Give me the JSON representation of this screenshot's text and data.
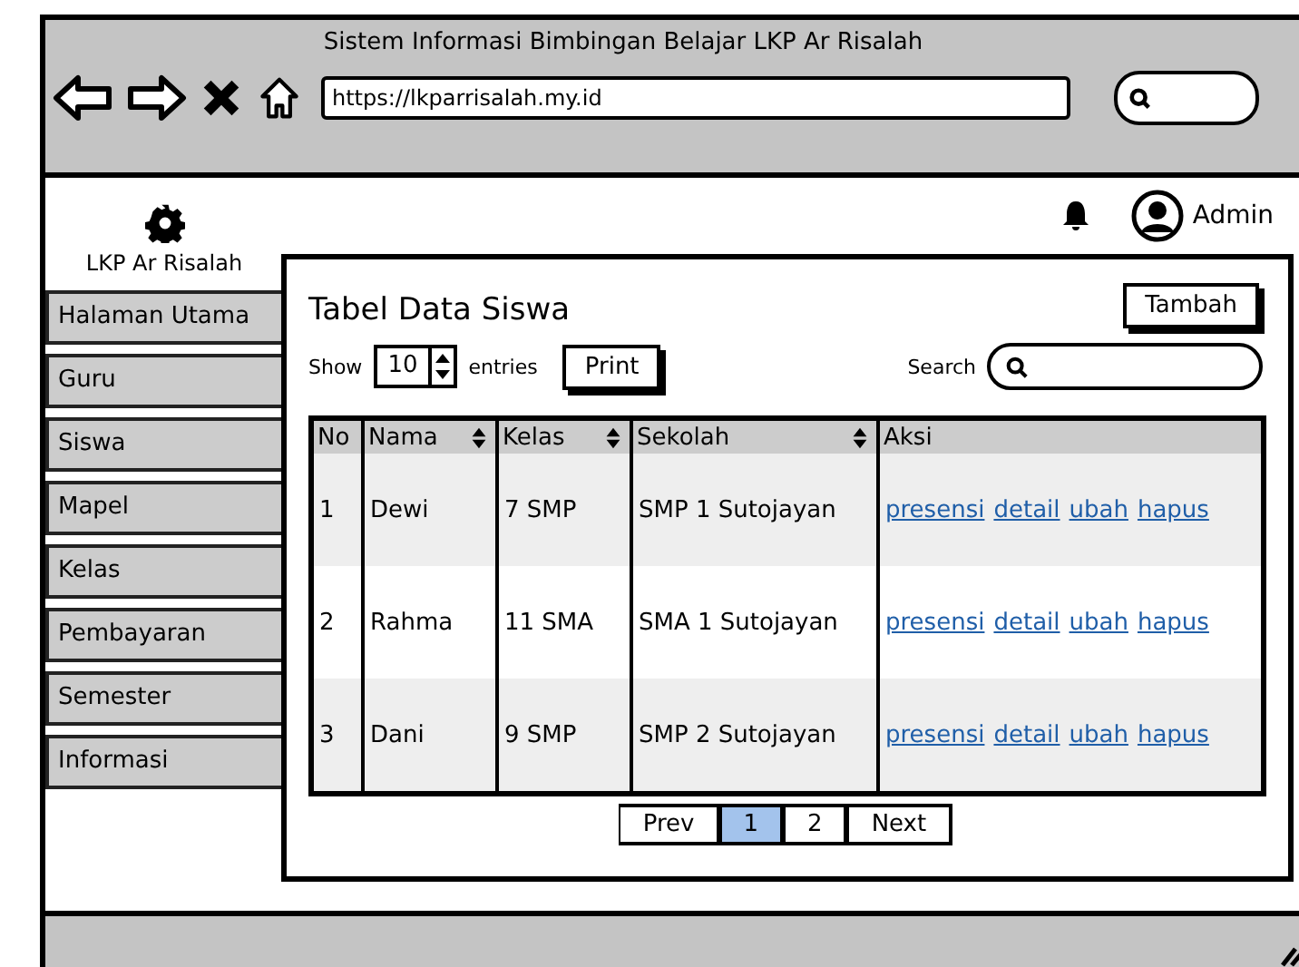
{
  "window": {
    "title": "Sistem Informasi Bimbingan Belajar LKP Ar Risalah",
    "url": "https://lkparrisalah.my.id"
  },
  "topbar": {
    "user": "Admin"
  },
  "sidebar": {
    "brand": "LKP Ar Risalah",
    "items": [
      {
        "label": "Halaman Utama"
      },
      {
        "label": "Guru"
      },
      {
        "label": "Siswa"
      },
      {
        "label": "Mapel"
      },
      {
        "label": "Kelas"
      },
      {
        "label": "Pembayaran"
      },
      {
        "label": "Semester"
      },
      {
        "label": "Informasi"
      }
    ]
  },
  "panel": {
    "title": "Tabel Data Siswa",
    "add_button": "Tambah",
    "show_label": "Show",
    "page_size": "10",
    "entries_label": "entries",
    "print_button": "Print",
    "search_label": "Search"
  },
  "table": {
    "columns": [
      {
        "label": "No",
        "sortable": false
      },
      {
        "label": "Nama",
        "sortable": true
      },
      {
        "label": "Kelas",
        "sortable": true
      },
      {
        "label": "Sekolah",
        "sortable": true
      },
      {
        "label": "Aksi",
        "sortable": false
      }
    ],
    "rows": [
      {
        "cells": [
          "1",
          "Dewi",
          "7 SMP",
          "SMP 1 Sutojayan"
        ],
        "actions": [
          "presensi",
          "detail",
          "ubah",
          "hapus"
        ]
      },
      {
        "cells": [
          "2",
          "Rahma",
          "11 SMA",
          "SMA 1 Sutojayan"
        ],
        "actions": [
          "presensi",
          "detail",
          "ubah",
          "hapus"
        ]
      },
      {
        "cells": [
          "3",
          "Dani",
          "9 SMP",
          "SMP 2 Sutojayan"
        ],
        "actions": [
          "presensi",
          "detail",
          "ubah",
          "hapus"
        ]
      }
    ]
  },
  "pagination": [
    {
      "label": "Prev",
      "selected": false
    },
    {
      "label": "1",
      "selected": true
    },
    {
      "label": "2",
      "selected": false
    },
    {
      "label": "Next",
      "selected": false
    }
  ]
}
